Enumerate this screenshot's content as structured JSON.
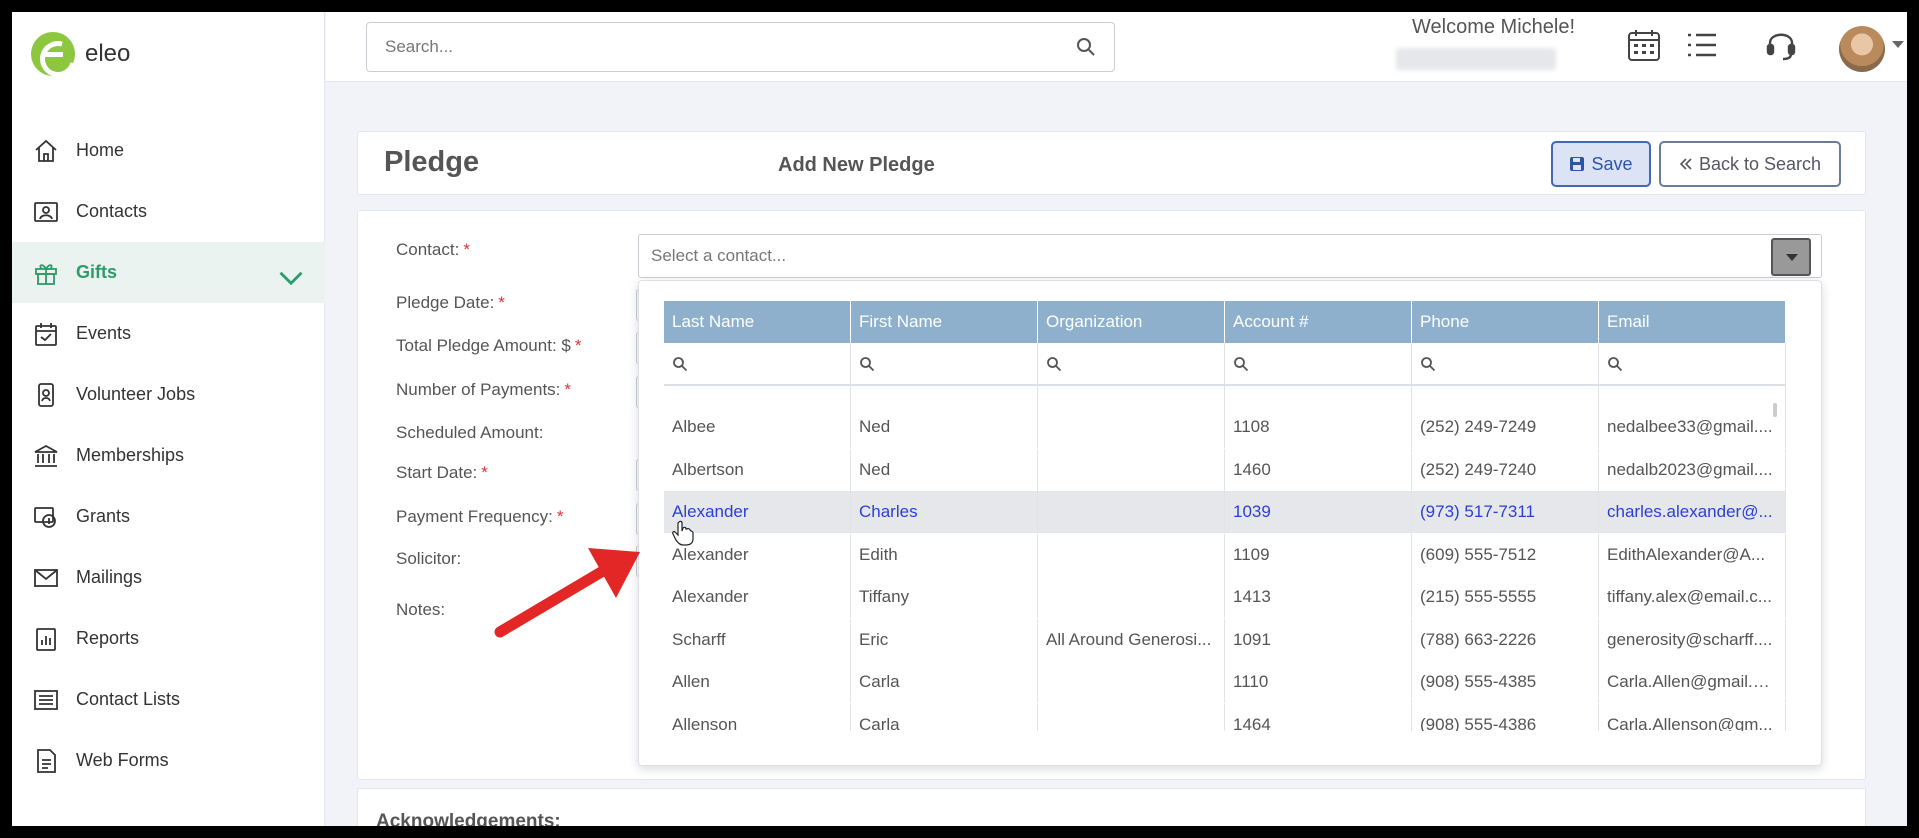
{
  "app": {
    "logo_text": "eleo"
  },
  "sidebar": {
    "items": [
      {
        "label": "Home",
        "icon": "home-icon"
      },
      {
        "label": "Contacts",
        "icon": "contact-card-icon"
      },
      {
        "label": "Gifts",
        "icon": "gift-icon",
        "active": true
      },
      {
        "label": "Events",
        "icon": "calendar-check-icon"
      },
      {
        "label": "Volunteer Jobs",
        "icon": "badge-icon"
      },
      {
        "label": "Memberships",
        "icon": "bank-icon"
      },
      {
        "label": "Grants",
        "icon": "money-icon"
      },
      {
        "label": "Mailings",
        "icon": "envelope-icon"
      },
      {
        "label": "Reports",
        "icon": "report-icon"
      },
      {
        "label": "Contact Lists",
        "icon": "list-icon"
      },
      {
        "label": "Web Forms",
        "icon": "form-icon"
      }
    ]
  },
  "header": {
    "search_placeholder": "Search...",
    "welcome": "Welcome Michele!"
  },
  "page": {
    "title": "Pledge",
    "subtitle": "Add New Pledge",
    "save_label": "Save",
    "back_label": "Back to Search"
  },
  "form": {
    "contact_label": "Contact:",
    "pledge_date_label": "Pledge Date:",
    "total_amount_label": "Total Pledge Amount: $",
    "num_payments_label": "Number of Payments:",
    "scheduled_amount_label": "Scheduled Amount:",
    "start_date_label": "Start Date:",
    "payment_frequency_label": "Payment Frequency:",
    "solicitor_label": "Solicitor:",
    "notes_label": "Notes:",
    "required_mark": "*",
    "contact_placeholder": "Select a contact..."
  },
  "grid": {
    "columns": [
      "Last Name",
      "First Name",
      "Organization",
      "Account #",
      "Phone",
      "Email"
    ],
    "rows": [
      [
        "Albee",
        "Ned",
        "",
        "1108",
        "(252) 249-7249",
        "nedalbee33@gmail...."
      ],
      [
        "Albertson",
        "Ned",
        "",
        "1460",
        "(252) 249-7240",
        "nedalb2023@gmail...."
      ],
      [
        "Alexander",
        "Charles",
        "",
        "1039",
        "(973) 517-7311",
        "charles.alexander@..."
      ],
      [
        "Alexander",
        "Edith",
        "",
        "1109",
        "(609) 555-7512",
        "EdithAlexander@A..."
      ],
      [
        "Alexander",
        "Tiffany",
        "",
        "1413",
        "(215) 555-5555",
        "tiffany.alex@email.c..."
      ],
      [
        "Scharff",
        "Eric",
        "All Around Generosi...",
        "1091",
        "(788) 663-2226",
        "generosity@scharff...."
      ],
      [
        "Allen",
        "Carla",
        "",
        "1110",
        "(908) 555-4385",
        "Carla.Allen@gmail.C..."
      ],
      [
        "Allenson",
        "Carla",
        "",
        "1464",
        "(908) 555-4386",
        "Carla.Allenson@gm..."
      ]
    ],
    "selected_row": 2
  },
  "acknowledgements": {
    "title": "Acknowledgements:"
  },
  "colors": {
    "accent": "#2e9c6a",
    "grid_header": "#8fb0cc",
    "selected_text": "#2a3fd6",
    "arrow": "#e32626"
  }
}
